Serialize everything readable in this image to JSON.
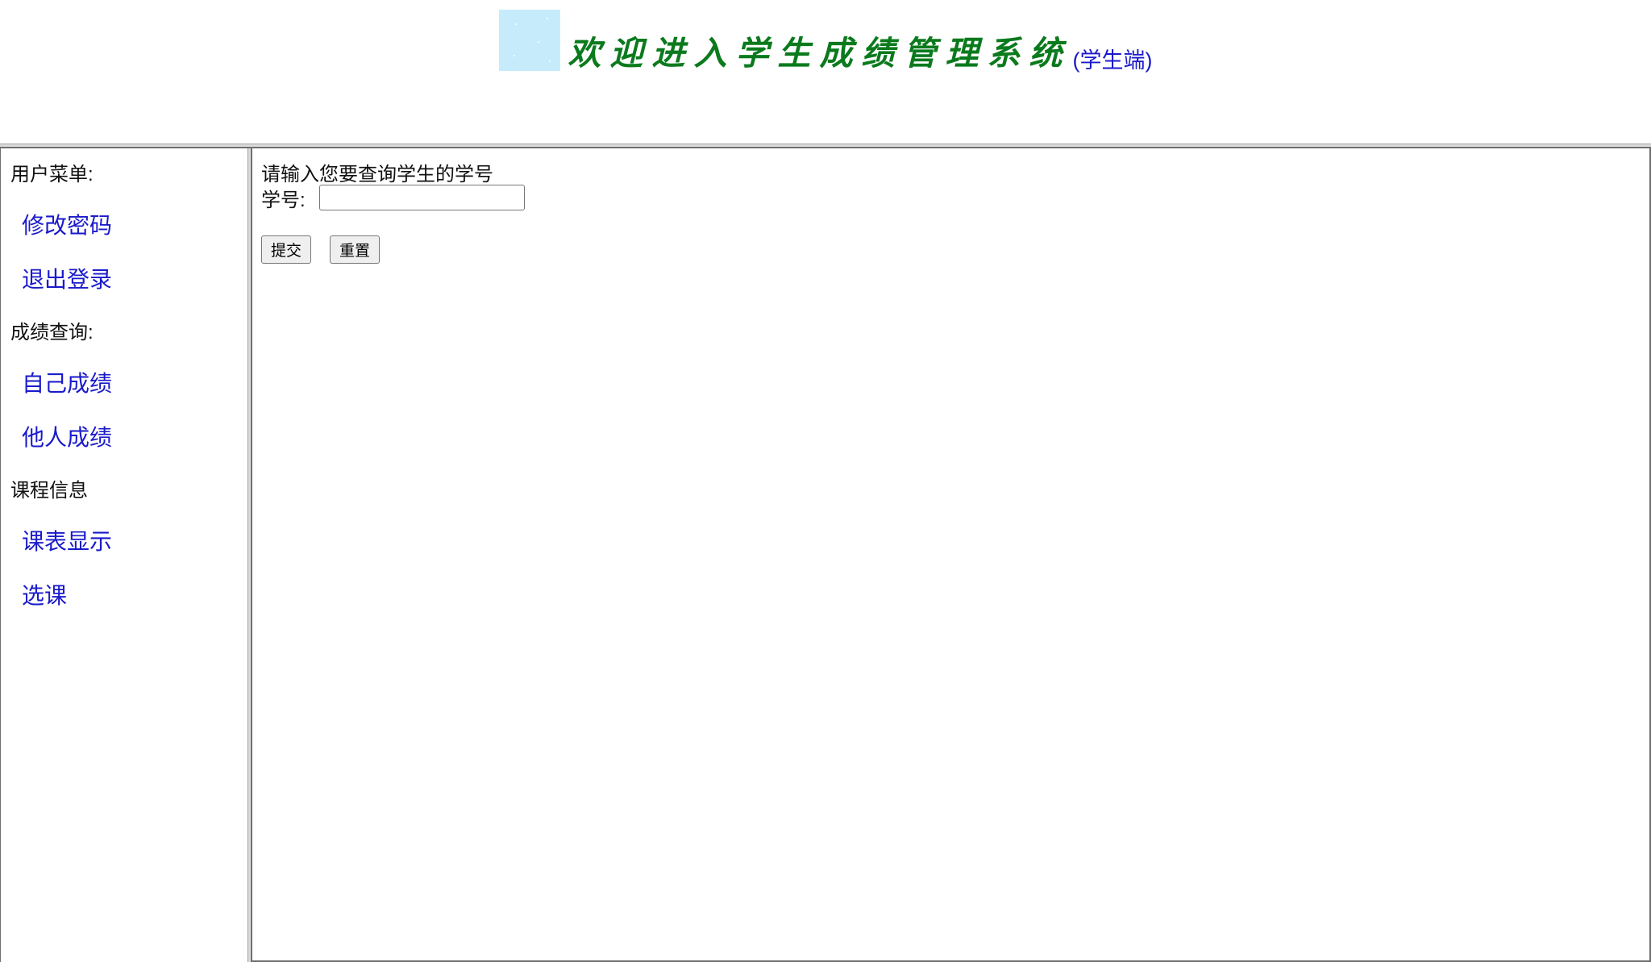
{
  "header": {
    "title": "欢迎进入学生成绩管理系统",
    "subtitle": "(学生端)",
    "logo_icon": "sky-tile-icon",
    "colors": {
      "title": "#0b7a1d",
      "subtitle": "#1a1acb",
      "logo_background": "#c6ecfb"
    }
  },
  "menu": {
    "sections": [
      {
        "label": "用户菜单:",
        "items": [
          {
            "label": "修改密码"
          },
          {
            "label": "退出登录"
          }
        ]
      },
      {
        "label": "成绩查询:",
        "items": [
          {
            "label": "自己成绩"
          },
          {
            "label": "他人成绩"
          }
        ]
      },
      {
        "label": "课程信息",
        "items": [
          {
            "label": "课表显示"
          },
          {
            "label": "选课"
          }
        ]
      }
    ],
    "colors": {
      "link": "#1a1acb",
      "section": "#111111"
    }
  },
  "main": {
    "prompt": "请输入您要查询学生的学号",
    "form": {
      "student_id_label": "学号:",
      "student_id_value": "",
      "submit_label": "提交",
      "reset_label": "重置"
    }
  }
}
